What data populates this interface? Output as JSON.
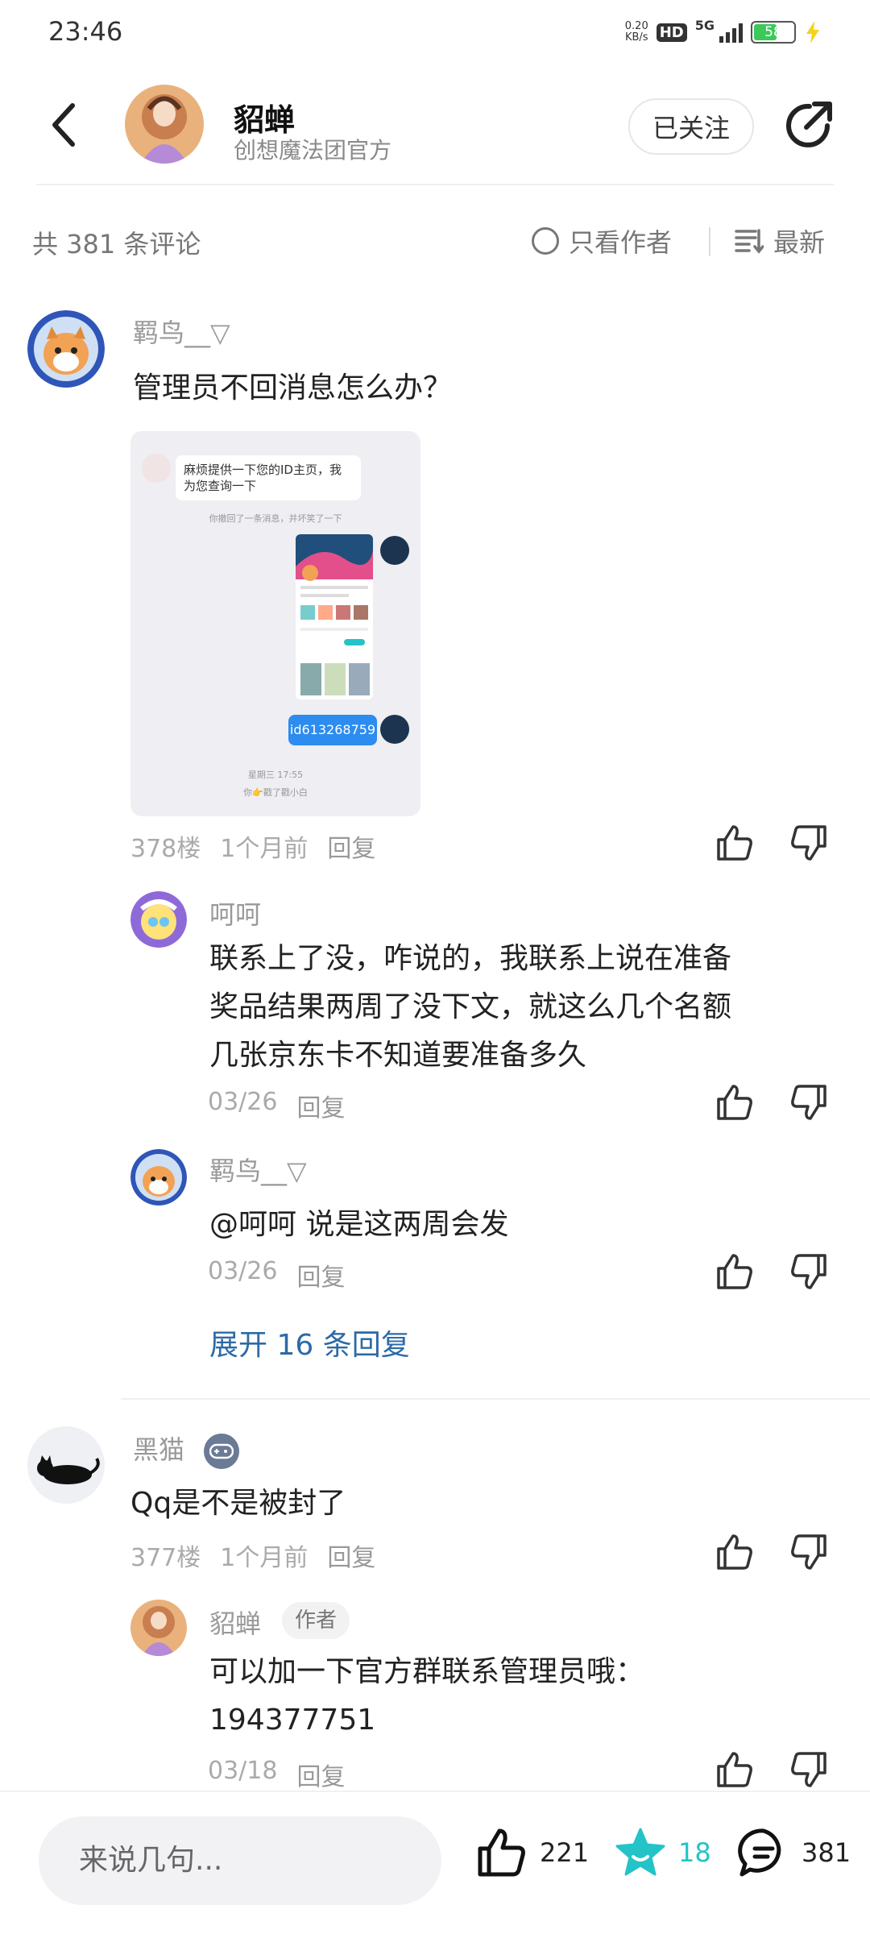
{
  "status_bar": {
    "time": "23:46",
    "net_speed_value": "0.20",
    "net_speed_unit": "KB/s",
    "hd": "HD",
    "network": "5G",
    "battery": "58",
    "battery_level": 0.58
  },
  "header": {
    "name": "貂蝉",
    "subtitle": "创想魔法团官方",
    "follow_label": "已关注"
  },
  "comments_bar": {
    "count_label": "共 381 条评论",
    "author_only_label": "只看作者",
    "sort_label": "最新"
  },
  "comments": [
    {
      "name": "羁鸟__▽",
      "text": "管理员不回消息怎么办？",
      "floor": "378楼",
      "time": "1个月前",
      "reply_label": "回复",
      "screenshot": {
        "message": "麻烦提供一下您的ID主页，我为您查询一下",
        "notice": "你撤回了一条消息，并坏笑了一下",
        "id_text": "id613268759",
        "date": "星期三 17:55",
        "poke": "你👉戳了戳小白"
      },
      "replies": [
        {
          "name": "呵呵",
          "text_lines": [
            "联系上了没，咋说的，我联系上说在准备",
            "奖品结果两周了没下文，就这么几个名额",
            "几张京东卡不知道要准备多久"
          ],
          "time": "03/26",
          "reply_label": "回复"
        },
        {
          "name": "羁鸟__▽",
          "text": "@呵呵 说是这两周会发",
          "time": "03/26",
          "reply_label": "回复"
        }
      ],
      "expand_label": "展开 16 条回复"
    },
    {
      "name": "黑猫",
      "text": "Qq是不是被封了",
      "floor": "377楼",
      "time": "1个月前",
      "reply_label": "回复",
      "replies": [
        {
          "name": "貂蝉",
          "badge": "作者",
          "text_lines": [
            "可以加一下官方群联系管理员哦：",
            "194377751"
          ],
          "time": "03/18",
          "reply_label": "回复"
        }
      ]
    }
  ],
  "bottom_bar": {
    "input_placeholder": "来说几句...",
    "like_count": "221",
    "star_count": "18",
    "comment_count": "381"
  },
  "colors": {
    "accent_teal": "#24c3c8",
    "link_blue": "#2d6aa6",
    "battery_green": "#3cc85a"
  }
}
